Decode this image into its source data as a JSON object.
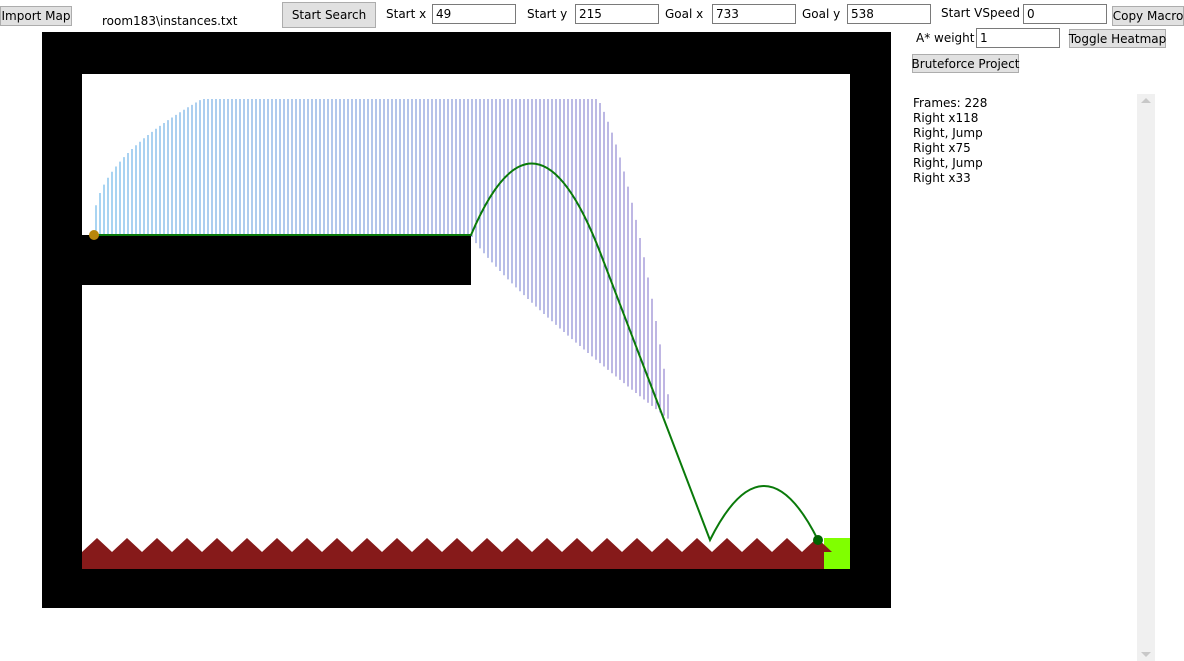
{
  "toolbar": {
    "import_map": "Import Map",
    "file_name": "room183\\instances.txt",
    "start_search": "Start Search",
    "start_x_label": "Start x",
    "start_x": "49",
    "start_y_label": "Start y",
    "start_y": "215",
    "goal_x_label": "Goal x",
    "goal_x": "733",
    "goal_y_label": "Goal y",
    "goal_y": "538",
    "start_vspeed_label": "Start VSpeed",
    "start_vspeed": "0",
    "copy_macro": "Copy Macro",
    "astar_weight_label": "A* weight",
    "astar_weight": "1",
    "toggle_heatmap": "Toggle Heatmap",
    "bruteforce_project": "Bruteforce Project"
  },
  "output": {
    "lines": [
      "Frames: 228",
      "Right x118",
      "Right, Jump",
      "Right x75",
      "Right, Jump",
      "Right x33"
    ]
  },
  "colors": {
    "wall": "#000000",
    "spike": "#861a1a",
    "goal": "#80ff00",
    "path": "#0a7a0a",
    "start_dot": "#b8860b",
    "end_dot": "#006400"
  }
}
